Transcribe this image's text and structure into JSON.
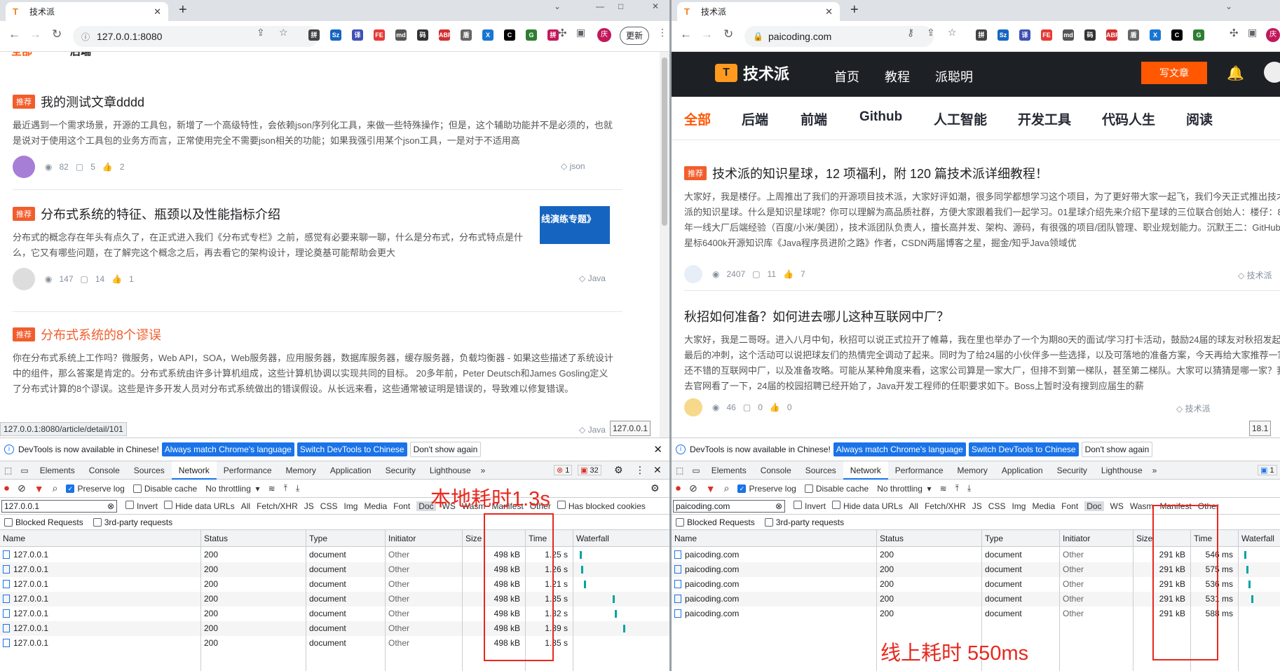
{
  "left": {
    "tab_title": "技术派",
    "url": "127.0.0.1:8080",
    "update_label": "更新",
    "extensions": [
      "拼",
      "Sz",
      "译",
      "FE",
      "md",
      "码",
      "ABP",
      "盾",
      "X",
      "C",
      "G",
      "拼"
    ],
    "avatar_text": "庆",
    "partial_top": [
      "全部",
      "后端"
    ],
    "articles": [
      {
        "tag": "推荐",
        "title": "我的测试文章dddd",
        "desc": "最近遇到一个需求场景，开源的工具包，新增了一个高级特性，会依赖json序列化工具，来做一些特殊操作；但是，这个辅助功能并不是必须的，也就是说对于使用这个工具包的业务方而言，正常使用完全不需要json相关的功能；如果我强引用某个json工具，一是对于不适用高",
        "views": "82",
        "comments": "5",
        "likes": "2",
        "topic": "json"
      },
      {
        "tag": "推荐",
        "title": "分布式系统的特征、瓶颈以及性能指标介绍",
        "desc": "分布式的概念存在年头有点久了，在正式进入我们《分布式专栏》之前，感觉有必要来聊一聊，什么是分布式，分布式特点是什么，它又有哪些问题，在了解完这个概念之后，再去看它的架构设计，理论奠基可能帮助会更大",
        "views": "147",
        "comments": "14",
        "likes": "1",
        "topic": "Java",
        "thumb_text": "线演练专题》"
      },
      {
        "tag": "推荐",
        "title": "分布式系统的8个谬误",
        "desc": "你在分布式系统上工作吗？微服务，Web API，SOA，Web服务器，应用服务器，数据库服务器，缓存服务器，负载均衡器 - 如果这些描述了系统设计中的组件，那么答案是肯定的。分布式系统由许多计算机组成，这些计算机协调以实现共同的目标。 20多年前，Peter Deutsch和James Gosling定义了分布式计算的8个谬误。这些是许多开发人员对分布式系统做出的错误假设。从长远来看，这些通常被证明是错误的，导致难以修复错误。",
        "topic": "Java"
      }
    ],
    "status_url": "127.0.0.1:8080/article/detail/101",
    "tooltip": "127.0.0.1",
    "errors": "1",
    "warnings": "32",
    "filter_value": "127.0.0.1",
    "rows": [
      {
        "name": "127.0.0.1",
        "status": "200",
        "type": "document",
        "initiator": "Other",
        "size": "498 kB",
        "time": "1.25 s",
        "wf": 0.03
      },
      {
        "name": "127.0.0.1",
        "status": "200",
        "type": "document",
        "initiator": "Other",
        "size": "498 kB",
        "time": "1.26 s",
        "wf": 0.05
      },
      {
        "name": "127.0.0.1",
        "status": "200",
        "type": "document",
        "initiator": "Other",
        "size": "498 kB",
        "time": "1.21 s",
        "wf": 0.08
      },
      {
        "name": "127.0.0.1",
        "status": "200",
        "type": "document",
        "initiator": "Other",
        "size": "498 kB",
        "time": "1.35 s",
        "wf": 0.46
      },
      {
        "name": "127.0.0.1",
        "status": "200",
        "type": "document",
        "initiator": "Other",
        "size": "498 kB",
        "time": "1.32 s",
        "wf": 0.49
      },
      {
        "name": "127.0.0.1",
        "status": "200",
        "type": "document",
        "initiator": "Other",
        "size": "498 kB",
        "time": "1.39 s",
        "wf": 0.6
      },
      {
        "name": "127.0.0.1",
        "status": "200",
        "type": "document",
        "initiator": "Other",
        "size": "498 kB",
        "time": "1.35 s",
        "wf": null
      }
    ],
    "annotation": "本地耗时1.3s"
  },
  "right": {
    "tab_title": "技术派",
    "url": "paicoding.com",
    "avatar_text": "庆",
    "logo_text": "技术派",
    "nav": [
      "首页",
      "教程",
      "派聪明"
    ],
    "write_label": "写文章",
    "categories": [
      "全部",
      "后端",
      "前端",
      "Github",
      "人工智能",
      "开发工具",
      "代码人生",
      "阅读"
    ],
    "articles": [
      {
        "tag": "推荐",
        "title": "技术派的知识星球，12 项福利，附 120 篇技术派详细教程！",
        "desc": "大家好，我是楼仔。上周推出了我们的开源项目技术派，大家好评如潮，很多同学都想学习这个项目，为了更好带大家一起飞，我们今天正式推出技术派的知识星球。什么是知识星球呢？你可以理解为高品质社群，方便大家跟着我们一起学习。01星球介绍先来介绍下星球的三位联合创始人：楼仔：8年一线大厂后端经验（百度/小米/美团），技术派团队负责人，擅长高并发、架构、源码，有很强的项目/团队管理、职业规划能力。沉默王二：GitHub星标6400k开源知识库《Java程序员进阶之路》作者，CSDN两届博客之星，掘金/知乎Java领域优",
        "views": "2407",
        "comments": "11",
        "likes": "7",
        "topic": "技术派"
      },
      {
        "title": "秋招如何准备？如何进去哪儿这种互联网中厂？",
        "desc": "大家好，我是二哥呀。进入八月中旬，秋招可以说正式拉开了帷幕，我在里也举办了一个为期80天的面试/学习打卡活动，鼓励24届的球友对秋招发起最后的冲刺，这个活动可以说把球友们的热情完全调动了起来。同时为了给24届的小伙伴多一些选择，以及可落地的准备方案，今天再给大家推荐一家还不错的互联网中厂，以及准备攻略。可能从某种角度来看，这家公司算是一家大厂，但排不到第一梯队，甚至第二梯队。大家可以猜猜是哪一家？我去官网看了一下，24届的校园招聘已经开始了，Java开发工程师的任职要求如下。Boss上暂时没有搜到应届生的薪",
        "views": "46",
        "comments": "0",
        "likes": "0",
        "topic": "技术派"
      }
    ],
    "tooltip": "18.1",
    "warnings": "1",
    "filter_value": "paicoding.com",
    "rows": [
      {
        "name": "paicoding.com",
        "status": "200",
        "type": "document",
        "initiator": "Other",
        "size": "291 kB",
        "time": "546 ms",
        "wf": 0.05
      },
      {
        "name": "paicoding.com",
        "status": "200",
        "type": "document",
        "initiator": "Other",
        "size": "291 kB",
        "time": "575 ms",
        "wf": 0.1
      },
      {
        "name": "paicoding.com",
        "status": "200",
        "type": "document",
        "initiator": "Other",
        "size": "291 kB",
        "time": "536 ms",
        "wf": 0.17
      },
      {
        "name": "paicoding.com",
        "status": "200",
        "type": "document",
        "initiator": "Other",
        "size": "291 kB",
        "time": "531 ms",
        "wf": 0.25
      },
      {
        "name": "paicoding.com",
        "status": "200",
        "type": "document",
        "initiator": "Other",
        "size": "291 kB",
        "time": "588 ms",
        "wf": null
      }
    ],
    "annotation": "线上耗时 550ms"
  },
  "devtools": {
    "info_text": "DevTools is now available in Chinese!",
    "btn_match": "Always match Chrome's language",
    "btn_switch": "Switch DevTools to Chinese",
    "btn_dismiss": "Don't show again",
    "tabs": [
      "Elements",
      "Console",
      "Sources",
      "Network",
      "Performance",
      "Memory",
      "Application",
      "Security",
      "Lighthouse"
    ],
    "preserve_log": "Preserve log",
    "disable_cache": "Disable cache",
    "throttling": "No throttling",
    "invert": "Invert",
    "hide_data_urls": "Hide data URLs",
    "filters": [
      "All",
      "Fetch/XHR",
      "JS",
      "CSS",
      "Img",
      "Media",
      "Font",
      "Doc",
      "WS",
      "Wasm",
      "Manifest",
      "Other"
    ],
    "has_blocked_cookies": "Has blocked cookies",
    "blocked_requests": "Blocked Requests",
    "third_party": "3rd-party requests",
    "columns": [
      "Name",
      "Status",
      "Type",
      "Initiator",
      "Size",
      "Time",
      "Waterfall"
    ]
  },
  "colors": {
    "accent": "#1a73e8",
    "brand": "#ff5702",
    "tag": "#f25d2c",
    "annotation": "#e8281e",
    "waterfall": "#00a3a3"
  }
}
